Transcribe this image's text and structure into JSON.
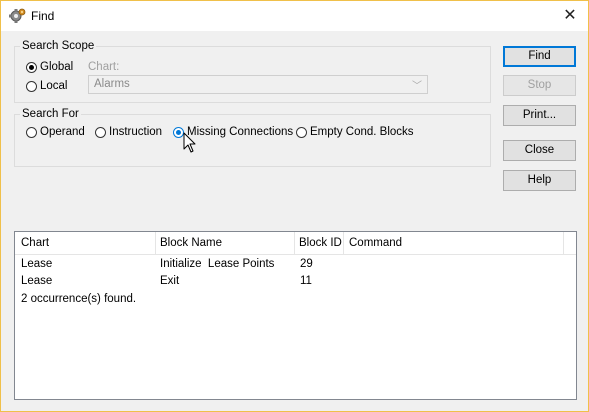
{
  "window": {
    "title": "Find",
    "title_icon": "gear-find-icon",
    "close_glyph": "✕"
  },
  "search_scope": {
    "label": "Search Scope",
    "options": [
      {
        "label": "Global",
        "checked": true
      },
      {
        "label": "Local",
        "checked": false
      }
    ],
    "chart_label": "Chart:",
    "chart_value": "Alarms"
  },
  "search_for": {
    "label": "Search For",
    "options": [
      {
        "label": "Operand",
        "checked": false
      },
      {
        "label": "Instruction",
        "checked": false
      },
      {
        "label": "Missing Connections",
        "checked": true
      },
      {
        "label": "Empty Cond. Blocks",
        "checked": false
      }
    ]
  },
  "buttons": {
    "find": "Find",
    "stop": "Stop",
    "print": "Print...",
    "close": "Close",
    "help": "Help"
  },
  "results": {
    "columns": [
      "Chart",
      "Block Name",
      "Block ID",
      "Command"
    ],
    "rows": [
      [
        "Lease",
        "Initialize  Lease Points",
        "29",
        ""
      ],
      [
        "Lease",
        "Exit",
        "11",
        ""
      ]
    ],
    "summary": "2 occurrence(s) found."
  },
  "colors": {
    "accent": "#0078d7",
    "border": "#dcdcdc",
    "window_border": "#f0c04a"
  }
}
